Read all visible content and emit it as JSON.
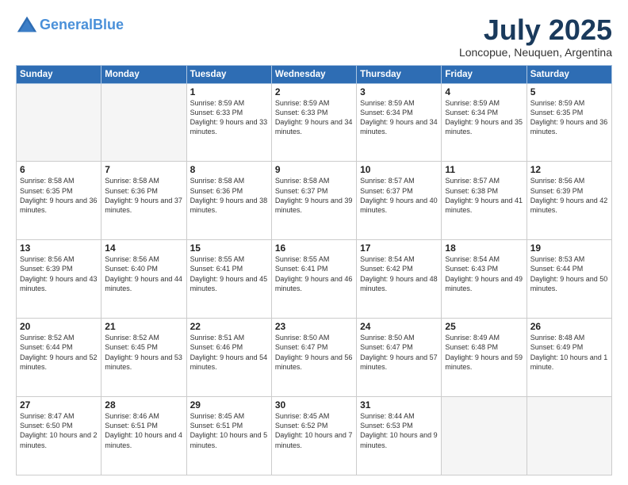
{
  "header": {
    "logo_line1": "General",
    "logo_line2": "Blue",
    "month_title": "July 2025",
    "location": "Loncopue, Neuquen, Argentina"
  },
  "weekdays": [
    "Sunday",
    "Monday",
    "Tuesday",
    "Wednesday",
    "Thursday",
    "Friday",
    "Saturday"
  ],
  "weeks": [
    [
      {
        "day": "",
        "sunrise": "",
        "sunset": "",
        "daylight": "",
        "empty": true
      },
      {
        "day": "",
        "sunrise": "",
        "sunset": "",
        "daylight": "",
        "empty": true
      },
      {
        "day": "1",
        "sunrise": "Sunrise: 8:59 AM",
        "sunset": "Sunset: 6:33 PM",
        "daylight": "Daylight: 9 hours and 33 minutes.",
        "empty": false
      },
      {
        "day": "2",
        "sunrise": "Sunrise: 8:59 AM",
        "sunset": "Sunset: 6:33 PM",
        "daylight": "Daylight: 9 hours and 34 minutes.",
        "empty": false
      },
      {
        "day": "3",
        "sunrise": "Sunrise: 8:59 AM",
        "sunset": "Sunset: 6:34 PM",
        "daylight": "Daylight: 9 hours and 34 minutes.",
        "empty": false
      },
      {
        "day": "4",
        "sunrise": "Sunrise: 8:59 AM",
        "sunset": "Sunset: 6:34 PM",
        "daylight": "Daylight: 9 hours and 35 minutes.",
        "empty": false
      },
      {
        "day": "5",
        "sunrise": "Sunrise: 8:59 AM",
        "sunset": "Sunset: 6:35 PM",
        "daylight": "Daylight: 9 hours and 36 minutes.",
        "empty": false
      }
    ],
    [
      {
        "day": "6",
        "sunrise": "Sunrise: 8:58 AM",
        "sunset": "Sunset: 6:35 PM",
        "daylight": "Daylight: 9 hours and 36 minutes.",
        "empty": false
      },
      {
        "day": "7",
        "sunrise": "Sunrise: 8:58 AM",
        "sunset": "Sunset: 6:36 PM",
        "daylight": "Daylight: 9 hours and 37 minutes.",
        "empty": false
      },
      {
        "day": "8",
        "sunrise": "Sunrise: 8:58 AM",
        "sunset": "Sunset: 6:36 PM",
        "daylight": "Daylight: 9 hours and 38 minutes.",
        "empty": false
      },
      {
        "day": "9",
        "sunrise": "Sunrise: 8:58 AM",
        "sunset": "Sunset: 6:37 PM",
        "daylight": "Daylight: 9 hours and 39 minutes.",
        "empty": false
      },
      {
        "day": "10",
        "sunrise": "Sunrise: 8:57 AM",
        "sunset": "Sunset: 6:37 PM",
        "daylight": "Daylight: 9 hours and 40 minutes.",
        "empty": false
      },
      {
        "day": "11",
        "sunrise": "Sunrise: 8:57 AM",
        "sunset": "Sunset: 6:38 PM",
        "daylight": "Daylight: 9 hours and 41 minutes.",
        "empty": false
      },
      {
        "day": "12",
        "sunrise": "Sunrise: 8:56 AM",
        "sunset": "Sunset: 6:39 PM",
        "daylight": "Daylight: 9 hours and 42 minutes.",
        "empty": false
      }
    ],
    [
      {
        "day": "13",
        "sunrise": "Sunrise: 8:56 AM",
        "sunset": "Sunset: 6:39 PM",
        "daylight": "Daylight: 9 hours and 43 minutes.",
        "empty": false
      },
      {
        "day": "14",
        "sunrise": "Sunrise: 8:56 AM",
        "sunset": "Sunset: 6:40 PM",
        "daylight": "Daylight: 9 hours and 44 minutes.",
        "empty": false
      },
      {
        "day": "15",
        "sunrise": "Sunrise: 8:55 AM",
        "sunset": "Sunset: 6:41 PM",
        "daylight": "Daylight: 9 hours and 45 minutes.",
        "empty": false
      },
      {
        "day": "16",
        "sunrise": "Sunrise: 8:55 AM",
        "sunset": "Sunset: 6:41 PM",
        "daylight": "Daylight: 9 hours and 46 minutes.",
        "empty": false
      },
      {
        "day": "17",
        "sunrise": "Sunrise: 8:54 AM",
        "sunset": "Sunset: 6:42 PM",
        "daylight": "Daylight: 9 hours and 48 minutes.",
        "empty": false
      },
      {
        "day": "18",
        "sunrise": "Sunrise: 8:54 AM",
        "sunset": "Sunset: 6:43 PM",
        "daylight": "Daylight: 9 hours and 49 minutes.",
        "empty": false
      },
      {
        "day": "19",
        "sunrise": "Sunrise: 8:53 AM",
        "sunset": "Sunset: 6:44 PM",
        "daylight": "Daylight: 9 hours and 50 minutes.",
        "empty": false
      }
    ],
    [
      {
        "day": "20",
        "sunrise": "Sunrise: 8:52 AM",
        "sunset": "Sunset: 6:44 PM",
        "daylight": "Daylight: 9 hours and 52 minutes.",
        "empty": false
      },
      {
        "day": "21",
        "sunrise": "Sunrise: 8:52 AM",
        "sunset": "Sunset: 6:45 PM",
        "daylight": "Daylight: 9 hours and 53 minutes.",
        "empty": false
      },
      {
        "day": "22",
        "sunrise": "Sunrise: 8:51 AM",
        "sunset": "Sunset: 6:46 PM",
        "daylight": "Daylight: 9 hours and 54 minutes.",
        "empty": false
      },
      {
        "day": "23",
        "sunrise": "Sunrise: 8:50 AM",
        "sunset": "Sunset: 6:47 PM",
        "daylight": "Daylight: 9 hours and 56 minutes.",
        "empty": false
      },
      {
        "day": "24",
        "sunrise": "Sunrise: 8:50 AM",
        "sunset": "Sunset: 6:47 PM",
        "daylight": "Daylight: 9 hours and 57 minutes.",
        "empty": false
      },
      {
        "day": "25",
        "sunrise": "Sunrise: 8:49 AM",
        "sunset": "Sunset: 6:48 PM",
        "daylight": "Daylight: 9 hours and 59 minutes.",
        "empty": false
      },
      {
        "day": "26",
        "sunrise": "Sunrise: 8:48 AM",
        "sunset": "Sunset: 6:49 PM",
        "daylight": "Daylight: 10 hours and 1 minute.",
        "empty": false
      }
    ],
    [
      {
        "day": "27",
        "sunrise": "Sunrise: 8:47 AM",
        "sunset": "Sunset: 6:50 PM",
        "daylight": "Daylight: 10 hours and 2 minutes.",
        "empty": false
      },
      {
        "day": "28",
        "sunrise": "Sunrise: 8:46 AM",
        "sunset": "Sunset: 6:51 PM",
        "daylight": "Daylight: 10 hours and 4 minutes.",
        "empty": false
      },
      {
        "day": "29",
        "sunrise": "Sunrise: 8:45 AM",
        "sunset": "Sunset: 6:51 PM",
        "daylight": "Daylight: 10 hours and 5 minutes.",
        "empty": false
      },
      {
        "day": "30",
        "sunrise": "Sunrise: 8:45 AM",
        "sunset": "Sunset: 6:52 PM",
        "daylight": "Daylight: 10 hours and 7 minutes.",
        "empty": false
      },
      {
        "day": "31",
        "sunrise": "Sunrise: 8:44 AM",
        "sunset": "Sunset: 6:53 PM",
        "daylight": "Daylight: 10 hours and 9 minutes.",
        "empty": false
      },
      {
        "day": "",
        "sunrise": "",
        "sunset": "",
        "daylight": "",
        "empty": true
      },
      {
        "day": "",
        "sunrise": "",
        "sunset": "",
        "daylight": "",
        "empty": true
      }
    ]
  ]
}
